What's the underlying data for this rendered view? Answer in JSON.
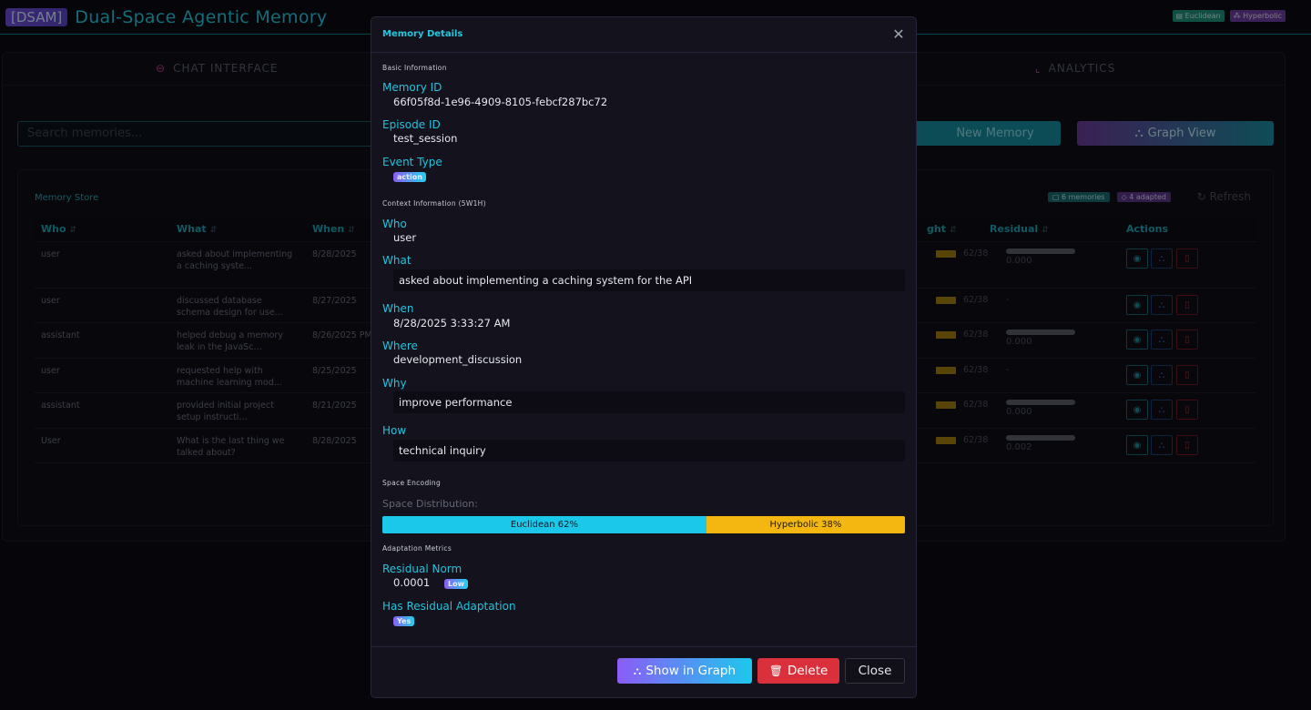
{
  "header": {
    "badge": "[DSAM]",
    "title": "Dual-Space Agentic Memory",
    "tags": [
      "▤ Euclidean",
      "⁂ Hyperbolic"
    ]
  },
  "tabs": {
    "chat": "CHAT INTERFACE",
    "analytics": "ANALYTICS"
  },
  "toolbar": {
    "search_placeholder": "Search memories...",
    "new_memory": "New Memory",
    "graph_view": "Graph View"
  },
  "store": {
    "title": "Memory Store",
    "memories_count": "6 memories",
    "adapted_count": "4 adapted",
    "refresh": "Refresh",
    "columns": {
      "who": "Who",
      "what": "What",
      "when": "When",
      "weight": "ght",
      "residual": "Residual",
      "actions": "Actions"
    },
    "rows": [
      {
        "who": "user",
        "what": "asked about implementing a caching syste...",
        "when": "8/28/2025",
        "weight": "62/38",
        "residual": "0.000",
        "has_bar": true
      },
      {
        "who": "user",
        "what": "discussed database schema design for use...",
        "when": "8/27/2025",
        "weight": "62/38",
        "residual": "-",
        "has_bar": false
      },
      {
        "who": "assistant",
        "what": "helped debug a memory leak in the JavaSc...",
        "when": "8/26/2025 PM",
        "weight": "62/38",
        "residual": "0.000",
        "has_bar": true
      },
      {
        "who": "user",
        "what": "requested help with machine learning mod...",
        "when": "8/25/2025",
        "weight": "62/38",
        "residual": "-",
        "has_bar": false
      },
      {
        "who": "assistant",
        "what": "provided initial project setup instructi...",
        "when": "8/21/2025",
        "weight": "62/38",
        "residual": "0.000",
        "has_bar": true
      },
      {
        "who": "User",
        "what": "What is the last thing we talked about?",
        "when": "8/28/2025",
        "weight": "62/38",
        "residual": "0.002",
        "has_bar": true
      }
    ]
  },
  "modal": {
    "title": "Memory Details",
    "basic_section": "Basic Information",
    "memory_id_label": "Memory ID",
    "memory_id": "66f05f8d-1e96-4909-8105-febcf287bc72",
    "episode_id_label": "Episode ID",
    "episode_id": "test_session",
    "event_type_label": "Event Type",
    "event_type": "action",
    "context_section": "Context Information (5W1H)",
    "who_label": "Who",
    "who": "user",
    "what_label": "What",
    "what": "asked about implementing a caching system for the API",
    "when_label": "When",
    "when": "8/28/2025 3:33:27 AM",
    "where_label": "Where",
    "where": "development_discussion",
    "why_label": "Why",
    "why": "improve performance",
    "how_label": "How",
    "how": "technical inquiry",
    "space_section": "Space Encoding",
    "distribution_label": "Space Distribution:",
    "euclidean_label": "Euclidean 62%",
    "hyperbolic_label": "Hyperbolic 38%",
    "euclidean_fraction": 0.62,
    "adaptation_section": "Adaptation Metrics",
    "residual_norm_label": "Residual Norm",
    "residual_norm": "0.0001",
    "residual_level": "Low",
    "has_adaptation_label": "Has Residual Adaptation",
    "has_adaptation": "Yes",
    "buttons": {
      "show_graph": "Show in Graph",
      "delete": "Delete",
      "close": "Close"
    }
  }
}
